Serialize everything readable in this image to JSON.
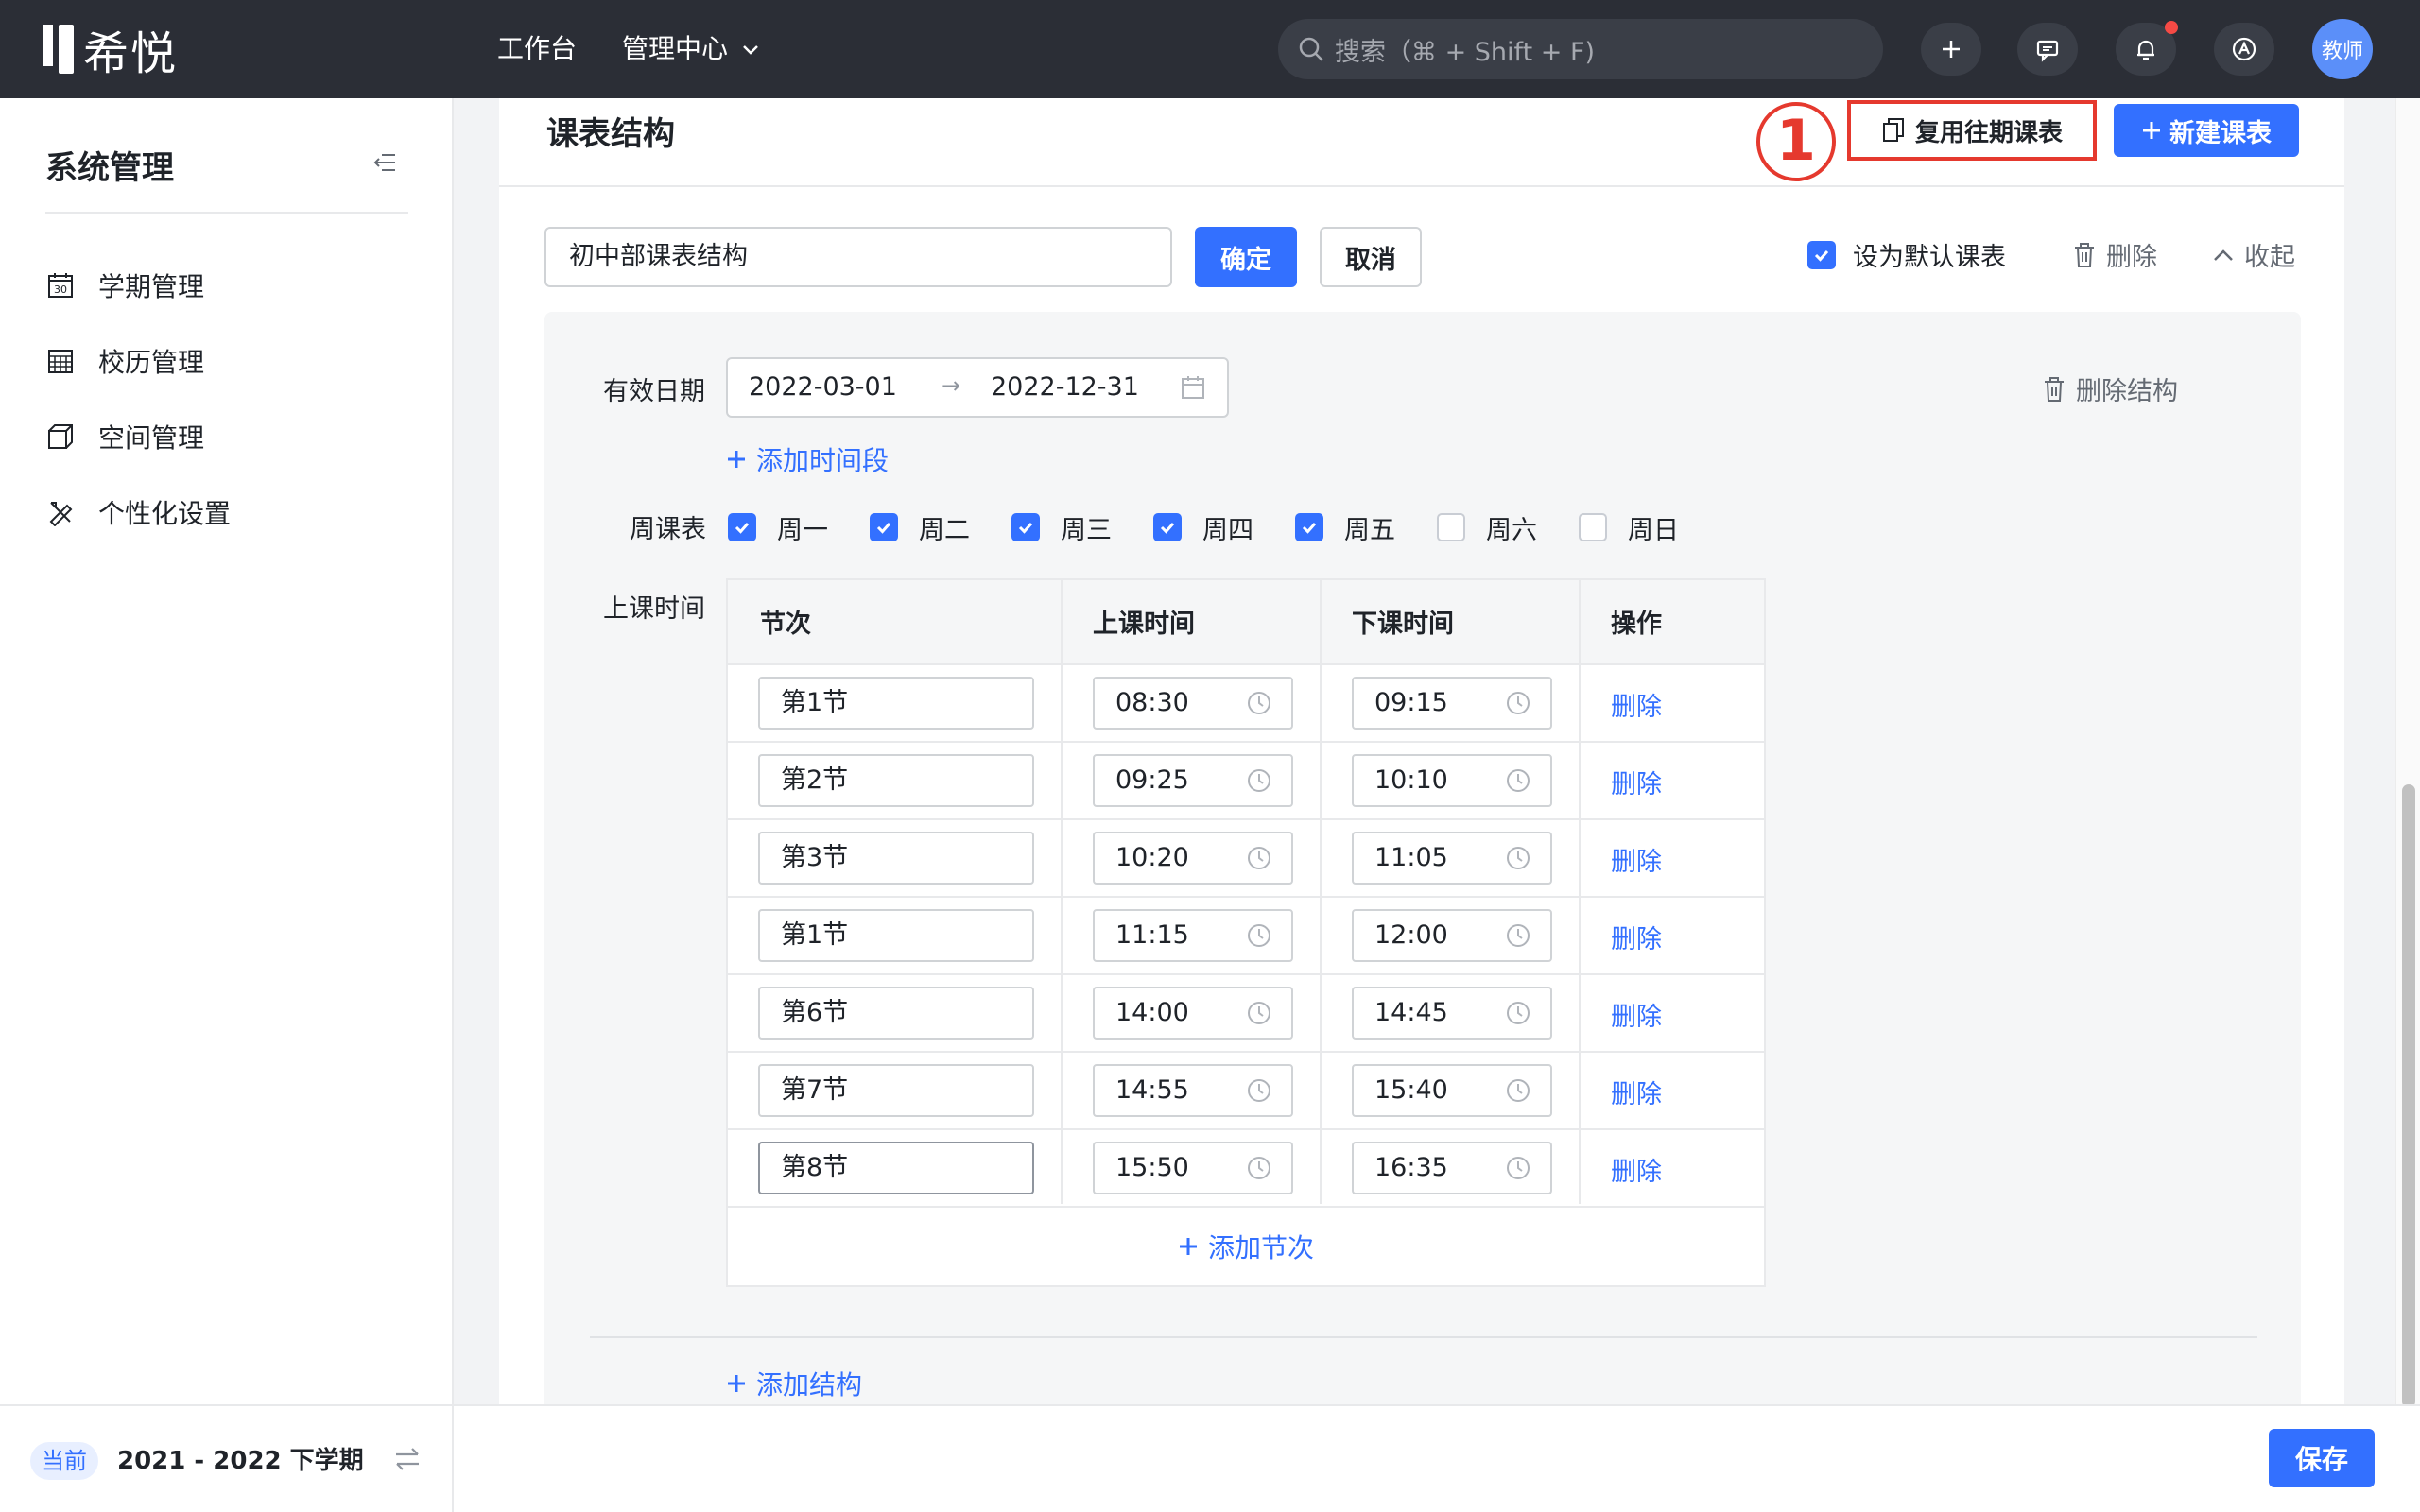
{
  "app": {
    "logo_text": "希悦"
  },
  "topbar": {
    "nav": {
      "workbench": "工作台",
      "admin_center": "管理中心"
    },
    "search_placeholder": "搜索（⌘ + Shift + F)",
    "avatar_label": "教师",
    "accent_color": "#3370ff"
  },
  "sidebar": {
    "title": "系统管理",
    "items": [
      {
        "label": "学期管理",
        "icon": "calendar-30-icon"
      },
      {
        "label": "校历管理",
        "icon": "calendar-grid-icon"
      },
      {
        "label": "空间管理",
        "icon": "cube-icon"
      },
      {
        "label": "个性化设置",
        "icon": "pencil-ruler-icon"
      }
    ],
    "footer": {
      "current_tag": "当前",
      "term": "2021 - 2022 下学期"
    }
  },
  "card": {
    "title": "课表结构",
    "annotation": "1",
    "reuse_button": "复用往期课表",
    "new_button": "新建课表"
  },
  "structure": {
    "name_value": "初中部课表结构",
    "confirm": "确定",
    "cancel": "取消",
    "default_label": "设为默认课表",
    "default_checked": true,
    "delete": "删除",
    "collapse": "收起"
  },
  "panel": {
    "date_label": "有效日期",
    "date_start": "2022-03-01",
    "date_end": "2022-12-31",
    "delete_structure": "删除结构",
    "add_period": "添加时间段",
    "weekly_label": "周课表",
    "weekdays": [
      {
        "label": "周一",
        "checked": true
      },
      {
        "label": "周二",
        "checked": true
      },
      {
        "label": "周三",
        "checked": true
      },
      {
        "label": "周四",
        "checked": true
      },
      {
        "label": "周五",
        "checked": true
      },
      {
        "label": "周六",
        "checked": false
      },
      {
        "label": "周日",
        "checked": false
      }
    ],
    "class_time_label": "上课时间",
    "table": {
      "headers": {
        "section": "节次",
        "start": "上课时间",
        "end": "下课时间",
        "action": "操作"
      },
      "rows": [
        {
          "name": "第1节",
          "start": "08:30",
          "end": "09:15",
          "action": "删除"
        },
        {
          "name": "第2节",
          "start": "09:25",
          "end": "10:10",
          "action": "删除"
        },
        {
          "name": "第3节",
          "start": "10:20",
          "end": "11:05",
          "action": "删除"
        },
        {
          "name": "第1节",
          "start": "11:15",
          "end": "12:00",
          "action": "删除"
        },
        {
          "name": "第6节",
          "start": "14:00",
          "end": "14:45",
          "action": "删除"
        },
        {
          "name": "第7节",
          "start": "14:55",
          "end": "15:40",
          "action": "删除"
        },
        {
          "name": "第8节",
          "start": "15:50",
          "end": "16:35",
          "action": "删除"
        }
      ],
      "add_section": "添加节次"
    },
    "add_structure": "添加结构"
  },
  "footer": {
    "save": "保存"
  }
}
